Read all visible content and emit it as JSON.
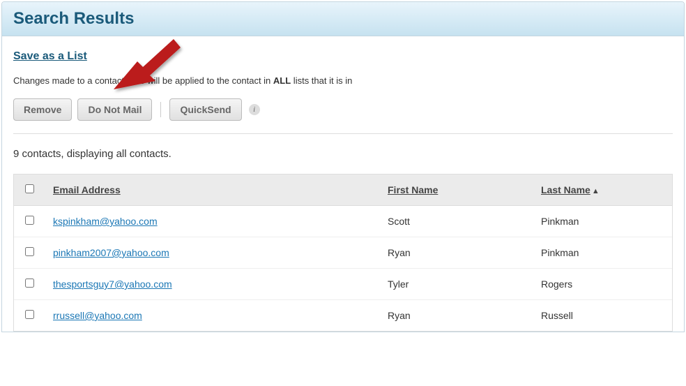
{
  "header": {
    "title": "Search Results"
  },
  "actions": {
    "save_link": "Save as a List",
    "info_prefix": "Changes made to a contact here will be applied to the contact in ",
    "info_bold": "ALL",
    "info_suffix": " lists that it is in"
  },
  "toolbar": {
    "remove": "Remove",
    "do_not_mail": "Do Not Mail",
    "quicksend": "QuickSend"
  },
  "summary": {
    "text": "9 contacts, displaying all contacts."
  },
  "table": {
    "columns": {
      "email": "Email Address",
      "first_name": "First Name",
      "last_name": "Last Name"
    },
    "sort_indicator": "▲",
    "rows": [
      {
        "email": "kspinkham@yahoo.com",
        "first_name": "Scott",
        "last_name": "Pinkman"
      },
      {
        "email": "pinkham2007@yahoo.com",
        "first_name": "Ryan",
        "last_name": "Pinkman"
      },
      {
        "email": "thesportsguy7@yahoo.com",
        "first_name": "Tyler",
        "last_name": "Rogers"
      },
      {
        "email": "rrussell@yahoo.com",
        "first_name": "Ryan",
        "last_name": "Russell"
      }
    ]
  }
}
